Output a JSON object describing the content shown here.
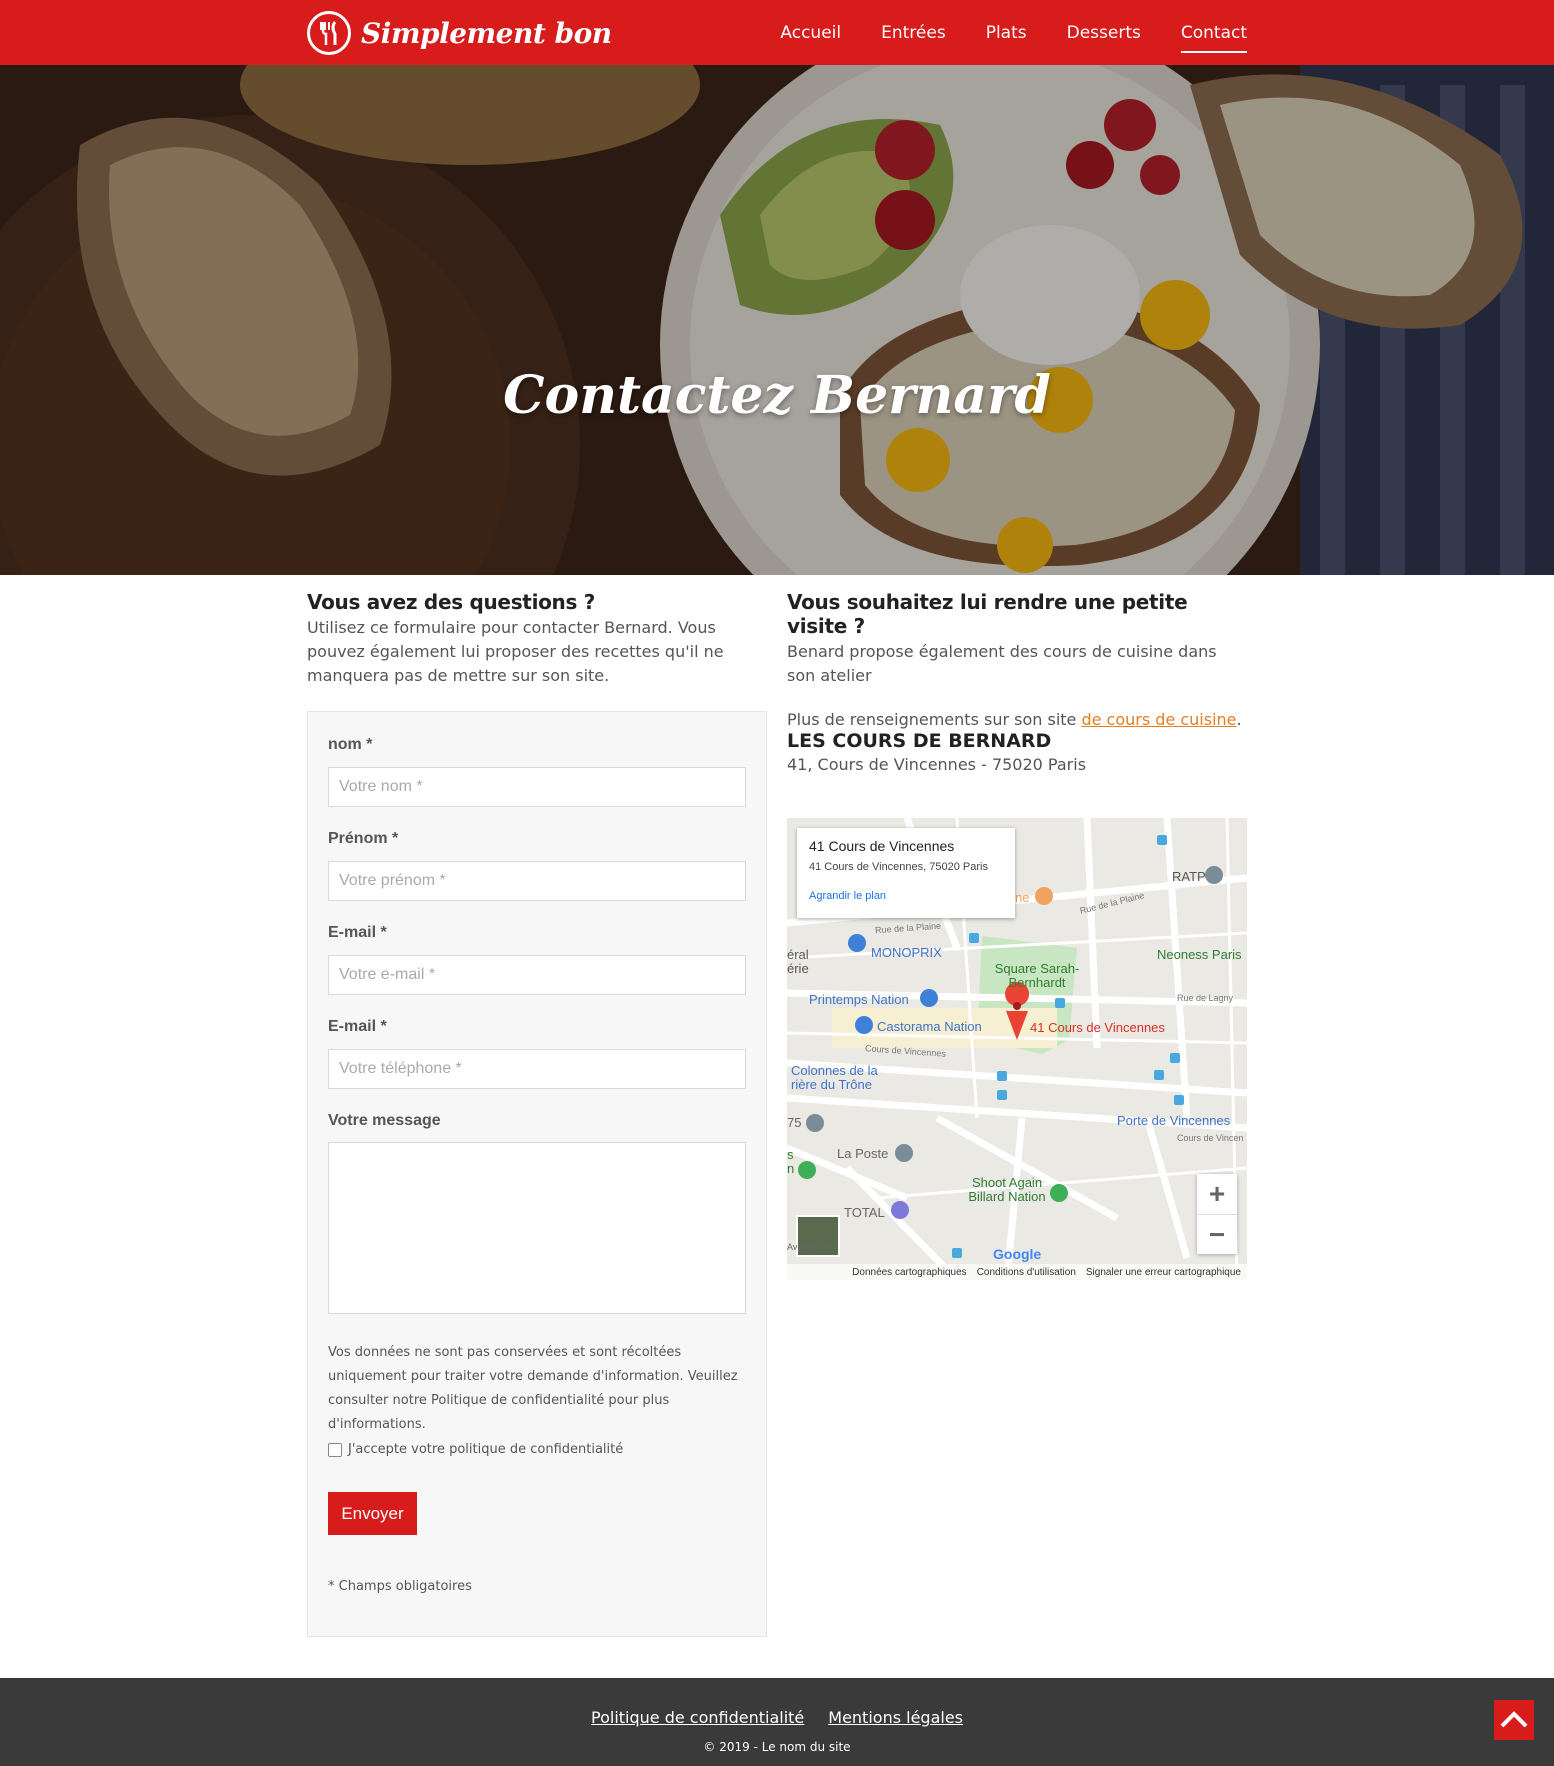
{
  "header": {
    "logo_text": "Simplement bon",
    "nav": [
      "Accueil",
      "Entrées",
      "Plats",
      "Desserts",
      "Contact"
    ],
    "active_nav": "Contact"
  },
  "hero": {
    "title": "Contactez Bernard"
  },
  "contact": {
    "title": "Vous avez des questions ?",
    "intro": "Utilisez ce formulaire pour contacter Bernard. Vous pouvez également lui proposer des recettes qu'il ne manquera pas de mettre sur son site.",
    "fields": [
      {
        "label": "nom *",
        "placeholder": "Votre nom *"
      },
      {
        "label": "Prénom *",
        "placeholder": "Votre prénom *"
      },
      {
        "label": "E-mail *",
        "placeholder": "Votre e-mail *"
      },
      {
        "label": "E-mail *",
        "placeholder": "Votre téléphone *"
      }
    ],
    "message_label": "Votre message",
    "privacy_text": "Vos données ne sont pas conservées et sont récoltées uniquement pour traiter votre demande d'information. Veuillez consulter notre Politique de confidentialité pour plus d'informations.",
    "consent_label": "J'accepte votre politique de confidentialité",
    "consent_checked": false,
    "submit_label": "Envoyer",
    "required_note": "* Champs obligatoires"
  },
  "visit": {
    "title": "Vous souhaitez lui rendre une petite visite ?",
    "intro": "Benard propose également des cours de cuisine dans son atelier",
    "more_prefix": "Plus de renseignements sur son site ",
    "more_link": "de cours de cuisine",
    "more_suffix": ".",
    "place_title": "LES COURS DE BERNARD",
    "address": "41, Cours de Vincennes - 75020 Paris"
  },
  "map": {
    "info_title": "41 Cours de Vincennes",
    "info_address": "41 Cours de Vincennes, 75020 Paris",
    "info_link": "Agrandir le plan",
    "labels": {
      "monoprix": "MONOPRIX",
      "printemps": "Printemps Nation",
      "castorama": "Castorama Nation",
      "marker": "41 Cours de Vincennes",
      "square": "Square Sarah-Bernhardt",
      "ratp": "RATP",
      "neoness": "Neoness Paris",
      "colonnes": "Colonnes de la rière du Trône",
      "porte": "Porte de Vincennes",
      "laposte": "La Poste",
      "total": "TOTAL",
      "shoot": "Shoot Again Billard Nation",
      "rue_plaine": "Rue de la Plaine",
      "rue_plaine2": "Rue de la Plaine",
      "cours_vincennes": "Cours de Vincennes",
      "rue_lagny": "Rue de Lagny",
      "eral": "éral érie",
      "ne": "ne",
      "num75": "75",
      "avenue": "Avenue de",
      "s_n": "s n",
      "cours_vinc2": "Cours de Vincen"
    },
    "zoom_in": "+",
    "zoom_out": "−",
    "footer": [
      "Données cartographiques",
      "Conditions d'utilisation",
      "Signaler une erreur cartographique"
    ],
    "google": "Google"
  },
  "footer": {
    "links": [
      "Politique de confidentialité",
      "Mentions légales"
    ],
    "copyright": "© 2019 - Le nom du site"
  },
  "colors": {
    "brand_red": "#d81b1b",
    "link_orange": "#e67e22",
    "footer_bg": "#3a3a3a"
  }
}
